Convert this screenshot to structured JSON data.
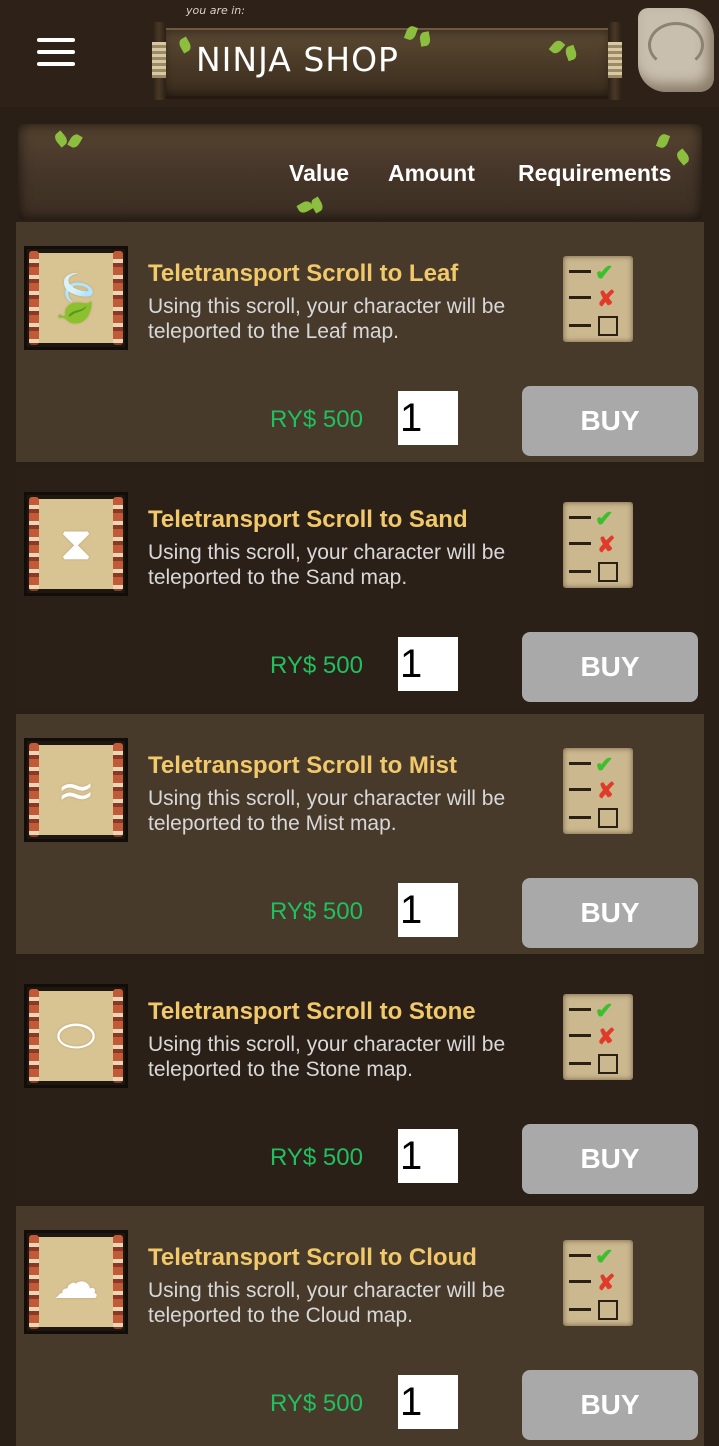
{
  "header": {
    "you_are_in": "you are in:",
    "title": "NINJA SHOP",
    "menu_icon": "hamburger-menu-icon",
    "bag_icon": "bag-icon"
  },
  "columns": {
    "value": "Value",
    "amount": "Amount",
    "requirements": "Requirements"
  },
  "items": [
    {
      "name": "Teletransport Scroll to Leaf",
      "desc": "Using this scroll, your character will be teleported to the Leaf map.",
      "price": "RY$ 500",
      "qty": "1",
      "buy": "BUY",
      "icon": "leaf-symbol-icon"
    },
    {
      "name": "Teletransport Scroll to Sand",
      "desc": "Using this scroll, your character will be teleported to the Sand map.",
      "price": "RY$ 500",
      "qty": "1",
      "buy": "BUY",
      "icon": "sand-symbol-icon"
    },
    {
      "name": "Teletransport Scroll to Mist",
      "desc": "Using this scroll, your character will be teleported to the Mist map.",
      "price": "RY$ 500",
      "qty": "1",
      "buy": "BUY",
      "icon": "mist-symbol-icon"
    },
    {
      "name": "Teletransport Scroll to Stone",
      "desc": "Using this scroll, your character will be teleported to the Stone map.",
      "price": "RY$ 500",
      "qty": "1",
      "buy": "BUY",
      "icon": "stone-symbol-icon"
    },
    {
      "name": "Teletransport Scroll to Cloud",
      "desc": "Using this scroll, your character will be teleported to the Cloud map.",
      "price": "RY$ 500",
      "qty": "1",
      "buy": "BUY",
      "icon": "cloud-symbol-icon"
    }
  ],
  "colors": {
    "item_name": "#f2c96a",
    "price": "#21c05f",
    "buy_button": "#a9a9a9",
    "row_light": "#473a2b",
    "row_dark": "#2b2018"
  }
}
